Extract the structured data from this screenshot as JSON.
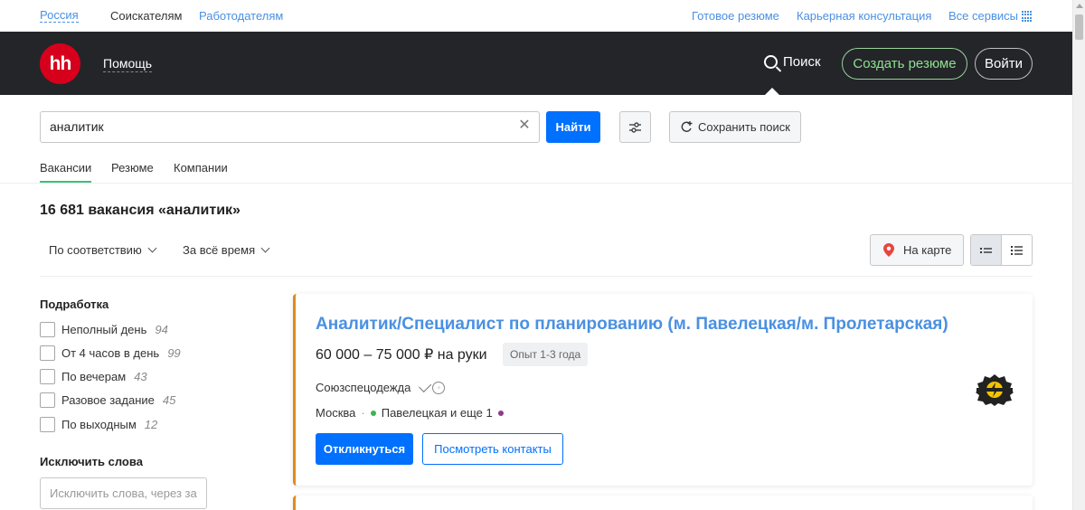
{
  "topbar": {
    "region": "Россия",
    "seekers": "Соискателям",
    "employers": "Работодателям",
    "ready_resume": "Готовое резюме",
    "career": "Карьерная консультация",
    "all_services": "Все сервисы"
  },
  "header": {
    "logo": "hh",
    "help": "Помощь",
    "search": "Поиск",
    "create_resume": "Создать резюме",
    "login": "Войти"
  },
  "search": {
    "value": "аналитик",
    "find_label": "Найти",
    "save_label": "Сохранить поиск"
  },
  "tabs": [
    "Вакансии",
    "Резюме",
    "Компании"
  ],
  "results": {
    "title": "16 681 вакансия «аналитик»",
    "sort_relevance": "По соответствию",
    "sort_period": "За всё время",
    "map_label": "На карте"
  },
  "filters": {
    "part_time_title": "Подработка",
    "items": [
      {
        "label": "Неполный день",
        "count": "94"
      },
      {
        "label": "От 4 часов в день",
        "count": "99"
      },
      {
        "label": "По вечерам",
        "count": "43"
      },
      {
        "label": "Разовое задание",
        "count": "45"
      },
      {
        "label": "По выходным",
        "count": "12"
      }
    ],
    "exclude_title": "Исключить слова",
    "exclude_placeholder": "Исключить слова, через за"
  },
  "vacancy": {
    "title": "Аналитик/Специалист по планированию (м. Павелецкая/м. Пролетарская)",
    "salary": "60 000 – 75 000 ₽ на руки",
    "experience": "Опыт 1-3 года",
    "company": "Союзспецодежда",
    "city": "Москва",
    "metro": "Павелецкая и еще 1",
    "respond_label": "Откликнуться",
    "contacts_label": "Посмотреть контакты"
  },
  "colors": {
    "header_bg": "#232529",
    "logo_red": "#d6001c",
    "link_blue": "#4a90e2",
    "primary_blue": "#0070ff",
    "create_green": "#8ee08e",
    "card_accent": "#e08a1e"
  }
}
